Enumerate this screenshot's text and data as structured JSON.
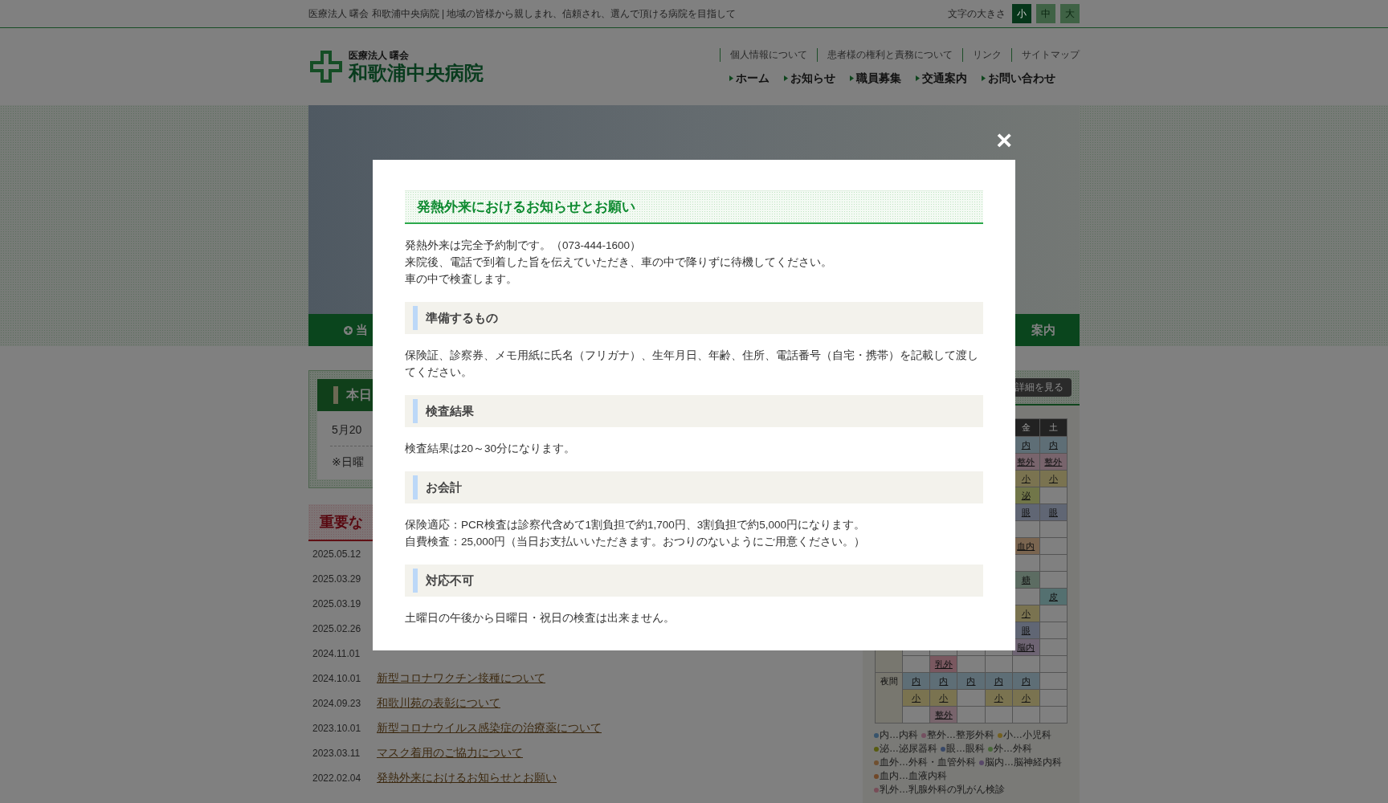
{
  "top_bar": {
    "tagline": "医療法人 曙会 和歌浦中央病院 | 地域の皆様から親しまれ、信頼され、選んで頂ける病院を目指して",
    "font_size_label": "文字の大きさ",
    "font_sizes": [
      {
        "label": "小",
        "selected": true
      },
      {
        "label": "中",
        "selected": false
      },
      {
        "label": "大",
        "selected": false
      }
    ]
  },
  "header": {
    "logo_sub": "医療法人 曙会",
    "logo_name": "和歌浦中央病院",
    "links": [
      "個人情報について",
      "患者様の権利と責務について",
      "リンク",
      "サイトマップ"
    ],
    "nav": [
      "ホーム",
      "お知らせ",
      "職員募集",
      "交通案内",
      "お問い合わせ"
    ]
  },
  "hero": {
    "nav": [
      "当",
      "案内"
    ]
  },
  "today": {
    "heading": "本日",
    "date": "5月20",
    "note": "※日曜"
  },
  "important": {
    "heading": "重要な",
    "news": [
      {
        "date": "2025.05.12"
      },
      {
        "date": "2025.03.29"
      },
      {
        "date": "2025.03.19"
      },
      {
        "date": "2025.02.26"
      },
      {
        "date": "2024.11.01"
      },
      {
        "date": "2024.10.01",
        "title": "新型コロナワクチン接種について"
      },
      {
        "date": "2024.09.23",
        "title": "和歌川苑の表彰について"
      },
      {
        "date": "2023.10.01",
        "title": "新型コロナウイルス感染症の治療薬について"
      },
      {
        "date": "2023.03.11",
        "title": "マスク着用のご協力について"
      },
      {
        "date": "2022.02.04",
        "title": "発熱外来におけるお知らせとお願い"
      }
    ]
  },
  "schedule": {
    "detail_button": "詳細を見る",
    "columns": [
      null,
      null,
      null,
      null,
      "金",
      "土"
    ],
    "groups": [
      {
        "rows": [
          [
            null,
            null,
            null,
            null,
            {
              "text": "内",
              "color": "#5e6e76"
            },
            {
              "text": "内",
              "color": "#5e6e76"
            }
          ],
          [
            null,
            null,
            null,
            null,
            {
              "text": "整外",
              "color": "#78646c"
            },
            {
              "text": "整外",
              "color": "#78646c"
            }
          ],
          [
            null,
            null,
            null,
            null,
            {
              "text": "小",
              "color": "#7a7350"
            },
            {
              "text": "小",
              "color": "#7a7350"
            }
          ],
          [
            null,
            null,
            null,
            null,
            {
              "text": "泌",
              "color": "#717649"
            },
            null
          ],
          [
            null,
            null,
            null,
            null,
            {
              "text": "眼",
              "color": "#606674"
            },
            {
              "text": "眼",
              "color": "#606674"
            }
          ],
          [
            null,
            null,
            null,
            null,
            null,
            null
          ],
          [
            null,
            null,
            null,
            null,
            {
              "text": "血内",
              "color": "#7a6550"
            },
            null
          ],
          [
            null,
            null,
            null,
            null,
            null,
            null
          ],
          [
            null,
            null,
            null,
            null,
            {
              "text": "糖",
              "color": "#5c6c62"
            },
            null
          ],
          [
            null,
            null,
            null,
            null,
            null,
            {
              "text": "皮",
              "color": "#547070"
            }
          ],
          [
            null,
            null,
            null,
            null,
            {
              "text": "小",
              "color": "#7a7350"
            },
            null
          ],
          [
            null,
            null,
            null,
            null,
            {
              "text": "眼",
              "color": "#606674"
            },
            null
          ],
          [
            null,
            null,
            null,
            null,
            {
              "text": "脳内",
              "color": "#6e6473"
            },
            null
          ],
          [
            null,
            {
              "text": "乳外",
              "color": "#7a5860"
            },
            null,
            null,
            null,
            null
          ]
        ]
      },
      {
        "label": "夜間",
        "rows": [
          [
            {
              "text": "内",
              "color": "#5e6e76"
            },
            {
              "text": "内",
              "color": "#5e6e76"
            },
            {
              "text": "内",
              "color": "#5e6e76"
            },
            {
              "text": "内",
              "color": "#5e6e76"
            },
            {
              "text": "内",
              "color": "#5e6e76"
            },
            null
          ],
          [
            {
              "text": "小",
              "color": "#7a7350"
            },
            {
              "text": "小",
              "color": "#7a7350"
            },
            null,
            {
              "text": "小",
              "color": "#7a7350"
            },
            {
              "text": "小",
              "color": "#7a7350"
            },
            null
          ],
          [
            null,
            {
              "text": "整外",
              "color": "#78646c"
            },
            null,
            null,
            null,
            null
          ]
        ]
      }
    ],
    "legend": [
      {
        "text": "内…内科",
        "color": "#38546c"
      },
      {
        "text": "整外…整形外科",
        "color": "#745060"
      },
      {
        "text": "小…小児科",
        "color": "#746020"
      },
      {
        "text": "泌…泌尿器科",
        "color": "#585c10"
      },
      {
        "text": "眼…眼科",
        "color": "#384868"
      },
      {
        "text": "外…外科",
        "color": "#486838"
      },
      {
        "text": "血外…外科・血管外科",
        "color": "#705030"
      },
      {
        "text": "脳内…脳神経内科",
        "color": "#584868"
      },
      {
        "text": "血内…血液内科",
        "color": "#704828"
      },
      {
        "text": "乳外…乳腺外科の乳がん検診",
        "color": "#784d58"
      }
    ]
  },
  "modal": {
    "close": "×",
    "title": "発熱外来におけるお知らせとお願い",
    "intro": [
      "発熱外来は完全予約制です。（073-444-1600）",
      "来院後、電話で到着した旨を伝えていただき、車の中で降りずに待機してください。",
      "車の中で検査します。"
    ],
    "sections": [
      {
        "heading": "準備するもの",
        "lines": [
          "保険証、診察券、メモ用紙に氏名（フリガナ）、生年月日、年齢、住所、電話番号（自宅・携帯）を記載して渡してください。"
        ]
      },
      {
        "heading": "検査結果",
        "lines": [
          "検査結果は20～30分になります。"
        ]
      },
      {
        "heading": "お会計",
        "lines": [
          "保険適応：PCR検査は診察代含めて1割負担で約1,700円、3割負担で約5,000円になります。",
          "自費検査：25,000円（当日お支払いいただきます。おつりのないようにご用意ください。）"
        ]
      },
      {
        "heading": "対応不可",
        "lines": [
          "土曜日の午後から日曜日・祝日の検査は出来ません。"
        ]
      }
    ]
  }
}
